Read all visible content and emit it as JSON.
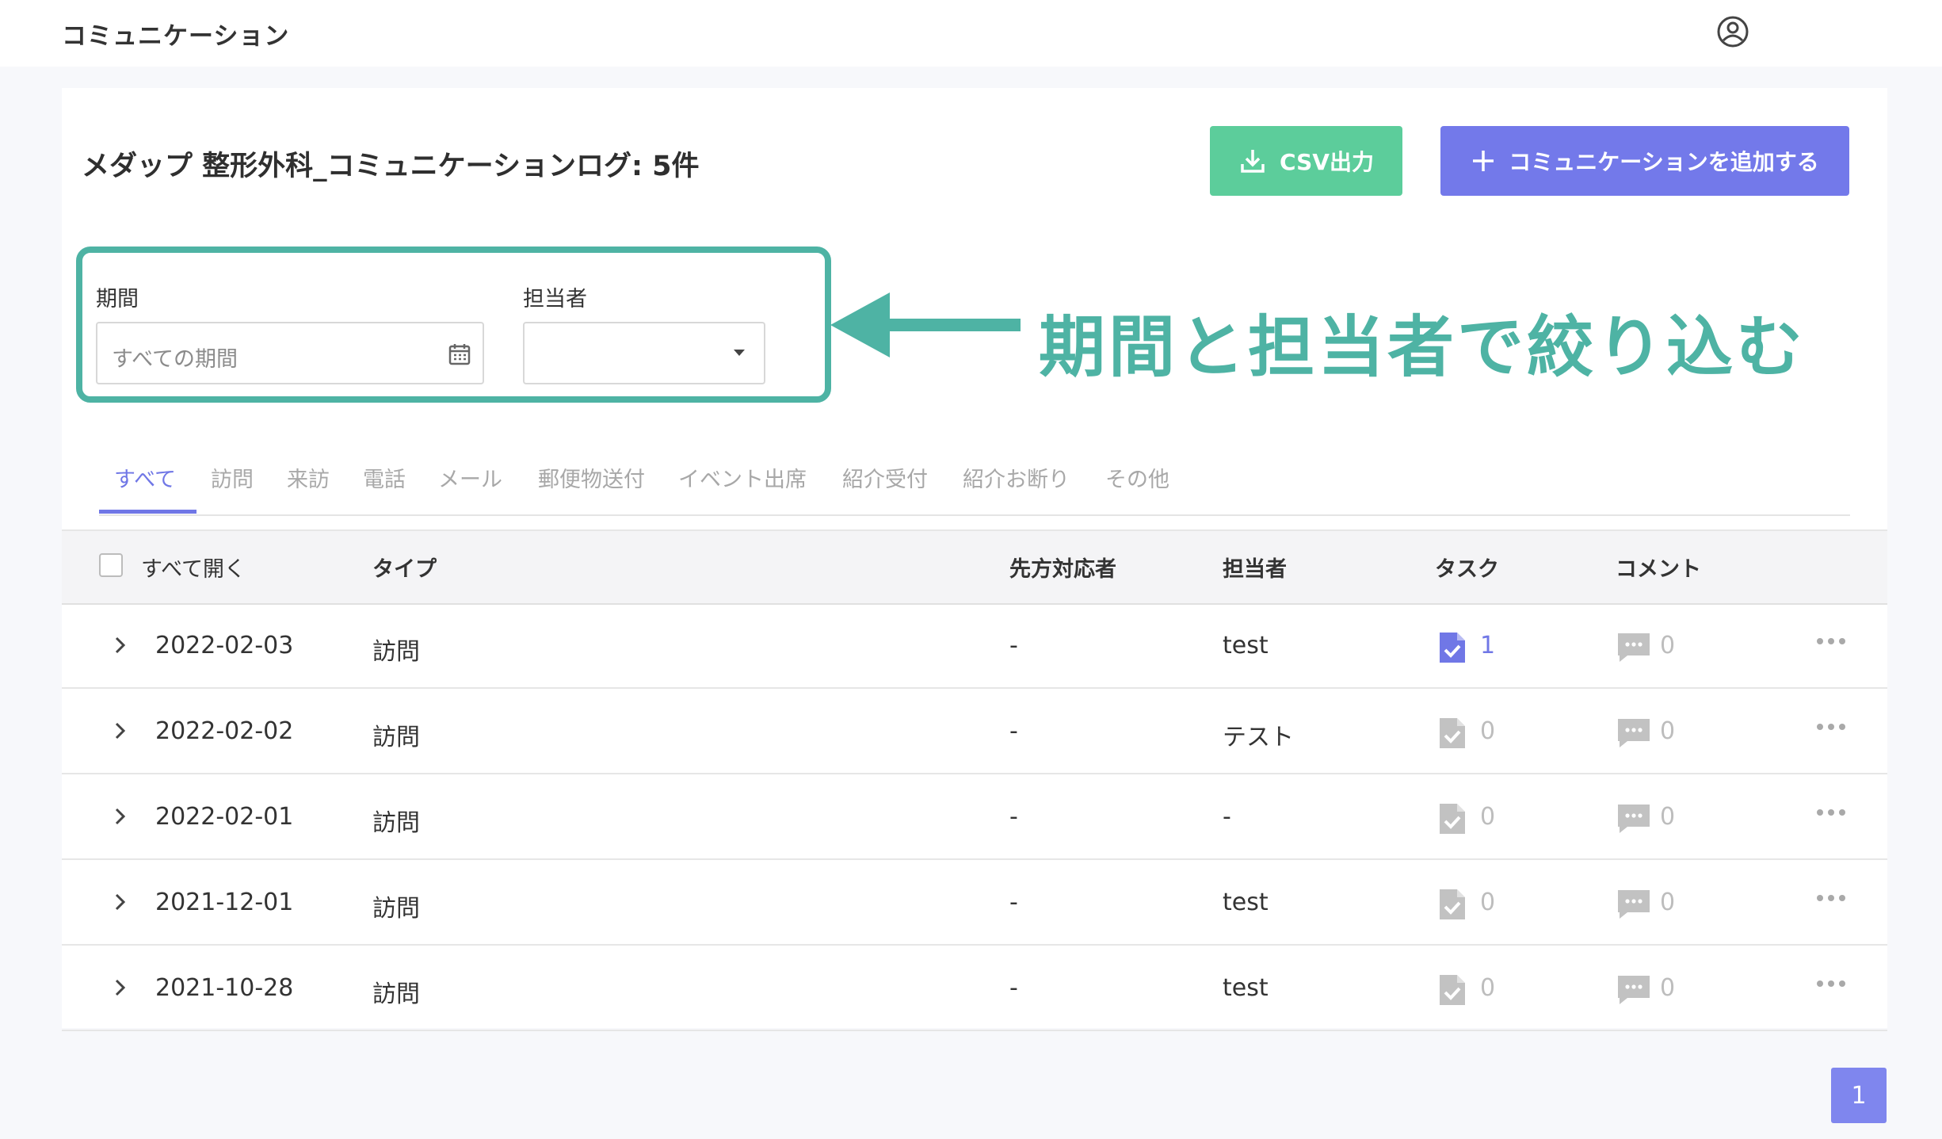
{
  "header": {
    "app_title": "コミュニケーション"
  },
  "page": {
    "title": "メダップ 整形外科_コミュニケーションログ: 5件",
    "csv_button": "CSV出力",
    "add_button": "コミュニケーションを追加する"
  },
  "filters": {
    "period_label": "期間",
    "period_placeholder": "すべての期間",
    "assignee_label": "担当者",
    "assignee_value": ""
  },
  "annotation": {
    "text": "期間と担当者で絞り込む"
  },
  "tabs": [
    {
      "label": "すべて",
      "active": true
    },
    {
      "label": "訪問"
    },
    {
      "label": "来訪"
    },
    {
      "label": "電話"
    },
    {
      "label": "メール"
    },
    {
      "label": "郵便物送付"
    },
    {
      "label": "イベント出席"
    },
    {
      "label": "紹介受付"
    },
    {
      "label": "紹介お断り"
    },
    {
      "label": "その他"
    }
  ],
  "table": {
    "headers": {
      "expand_all": "すべて開く",
      "type": "タイプ",
      "counterpart": "先方対応者",
      "assignee": "担当者",
      "task": "タスク",
      "comment": "コメント"
    },
    "rows": [
      {
        "date": "2022-02-03",
        "type": "訪問",
        "counterpart": "-",
        "assignee": "test",
        "tasks": "1",
        "comments": "0",
        "task_active": true
      },
      {
        "date": "2022-02-02",
        "type": "訪問",
        "counterpart": "-",
        "assignee": "テスト",
        "tasks": "0",
        "comments": "0"
      },
      {
        "date": "2022-02-01",
        "type": "訪問",
        "counterpart": "-",
        "assignee": "-",
        "tasks": "0",
        "comments": "0"
      },
      {
        "date": "2021-12-01",
        "type": "訪問",
        "counterpart": "-",
        "assignee": "test",
        "tasks": "0",
        "comments": "0"
      },
      {
        "date": "2021-10-28",
        "type": "訪問",
        "counterpart": "-",
        "assignee": "test",
        "tasks": "0",
        "comments": "0"
      }
    ]
  },
  "pagination": {
    "current": "1"
  },
  "colors": {
    "accent": "#7077e6",
    "csv_green": "#5ccd9b",
    "annotation_teal": "#4eb3a4"
  }
}
